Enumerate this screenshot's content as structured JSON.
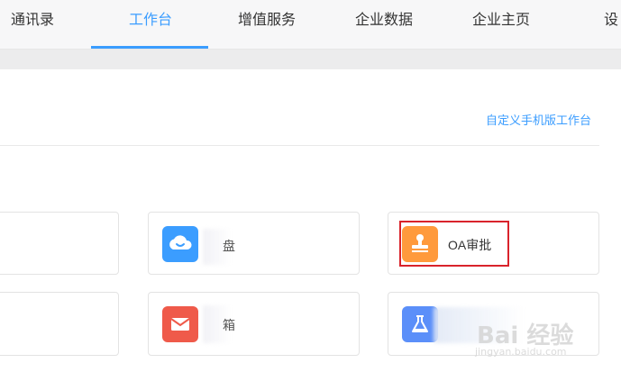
{
  "nav": {
    "tabs": [
      {
        "label": "通讯录",
        "active": false
      },
      {
        "label": "工作台",
        "active": true
      },
      {
        "label": "增值服务",
        "active": false
      },
      {
        "label": "企业数据",
        "active": false
      },
      {
        "label": "企业主页",
        "active": false
      },
      {
        "label": "设",
        "active": false
      }
    ],
    "accent_color": "#3b9dff"
  },
  "toolbar": {
    "custom_mobile_workbench_link": "自定义手机版工作台"
  },
  "apps": [
    {
      "label": "",
      "icon": "cloud-icon",
      "icon_color": "#3b9dff",
      "partial_label": "盘"
    },
    {
      "label": "OA审批",
      "icon": "stamp-icon",
      "icon_color": "#ff9a3c",
      "highlighted": true
    },
    {
      "label": "",
      "icon": "mail-icon",
      "icon_color": "#ef5a4a",
      "partial_label": "箱"
    },
    {
      "label": "",
      "icon": "flask-icon",
      "icon_color": "#5b8ff9"
    }
  ],
  "watermark": {
    "text": "Bai 经验",
    "sub": "jingyan.baidu.com"
  }
}
